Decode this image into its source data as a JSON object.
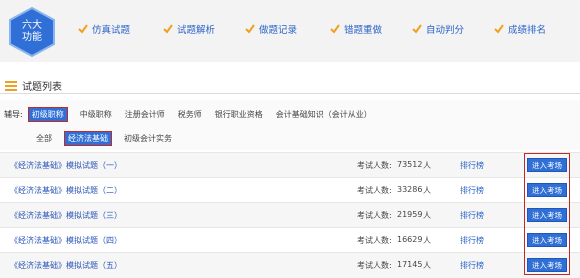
{
  "badge": {
    "line1": "六大",
    "line2": "功能"
  },
  "features": [
    {
      "label": "仿真试题"
    },
    {
      "label": "试题解析"
    },
    {
      "label": "做题记录"
    },
    {
      "label": "错题重做"
    },
    {
      "label": "自动判分"
    },
    {
      "label": "成绩排名"
    }
  ],
  "section": {
    "title": "试题列表"
  },
  "filters": {
    "row1_label": "辅导:",
    "row1_items": [
      "初级职称",
      "中级职称",
      "注册会计师",
      "税务师",
      "银行职业资格",
      "会计基础知识（会计从业）"
    ],
    "row2_items": [
      "全部",
      "经济法基础",
      "初级会计实务"
    ]
  },
  "exams": [
    {
      "title": "《经济法基础》模拟试题（一）",
      "count_label": "考试人数:",
      "count": "73512",
      "unit": "人",
      "rank": "排行榜",
      "enter": "进入考场"
    },
    {
      "title": "《经济法基础》模拟试题（二）",
      "count_label": "考试人数:",
      "count": "33286",
      "unit": "人",
      "rank": "排行榜",
      "enter": "进入考场"
    },
    {
      "title": "《经济法基础》模拟试题（三）",
      "count_label": "考试人数:",
      "count": "21959",
      "unit": "人",
      "rank": "排行榜",
      "enter": "进入考场"
    },
    {
      "title": "《经济法基础》模拟试题（四）",
      "count_label": "考试人数:",
      "count": "16629",
      "unit": "人",
      "rank": "排行榜",
      "enter": "进入考场"
    },
    {
      "title": "《经济法基础》模拟试题（五）",
      "count_label": "考试人数:",
      "count": "17145",
      "unit": "人",
      "rank": "排行榜",
      "enter": "进入考场"
    }
  ],
  "colors": {
    "accent": "#2f6fd6",
    "check": "#f0a020",
    "highlight": "#c62828"
  },
  "icons": {
    "badge": "hexagon-badge-icon",
    "feature": "check-icon",
    "section": "list-icon"
  }
}
